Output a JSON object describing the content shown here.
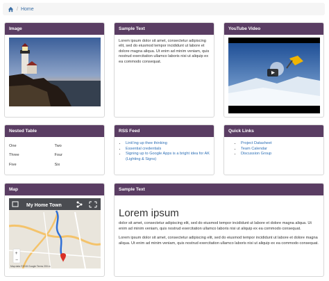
{
  "breadcrumb": {
    "home_label": "Home"
  },
  "panels": {
    "image": {
      "title": "Image"
    },
    "sample_text": {
      "title": "Sample Text",
      "body": "Lorem ipsum dolor sit amet, consectetur adipiscing elit, sed do eiusmod tempor incididunt ut labore et dolore magna aliqua. Ut enim ad minim veniam, quis nostrud exercitation ullamco laboris nisi ut aliquip ex ea commodo consequat."
    },
    "youtube": {
      "title": "YouTube Video"
    },
    "nested_table": {
      "title": "Nested Table",
      "rows": [
        [
          "One",
          "Two"
        ],
        [
          "Three",
          "Four"
        ],
        [
          "Five",
          "Six"
        ]
      ]
    },
    "rss": {
      "title": "RSS Feed",
      "items": [
        "Link'ing up thee thinking",
        "Essential credentials",
        "Signing up to Google Apps is a bright idea for AK (Lighting & Signs)"
      ]
    },
    "quick_links": {
      "title": "Quick Links",
      "items": [
        "Project Datasheet",
        "Team Calendar",
        "Discussion Group"
      ]
    },
    "map": {
      "title": "Map",
      "map_title": "My Home Town",
      "attribution": "Map data ©2015 Google  Terms  200 m"
    },
    "sample_text_2": {
      "title": "Sample Text",
      "heading": "Lorem ipsum",
      "para1": "dolor sit amet, consectetur adipiscing elit, sed do eiusmod tempor incididunt ut labore et dolore magna aliqua. Ut enim ad minim veniam, quis nostrud exercitation ullamco laboris nisi ut aliquip ex ea commodo consequat.",
      "para2": "Lorem ipsum dolor sit amet, consectetur adipiscing elit, sed do eiusmod tempor incididunt ut labore et dolore magna aliqua. Ut enim ad minim veniam, quis nostrud exercitation ullamco laboris nisi ut aliquip ex ea commodo consequat."
    }
  },
  "colors": {
    "header": "#5a3d63",
    "link": "#2c6eb5"
  }
}
